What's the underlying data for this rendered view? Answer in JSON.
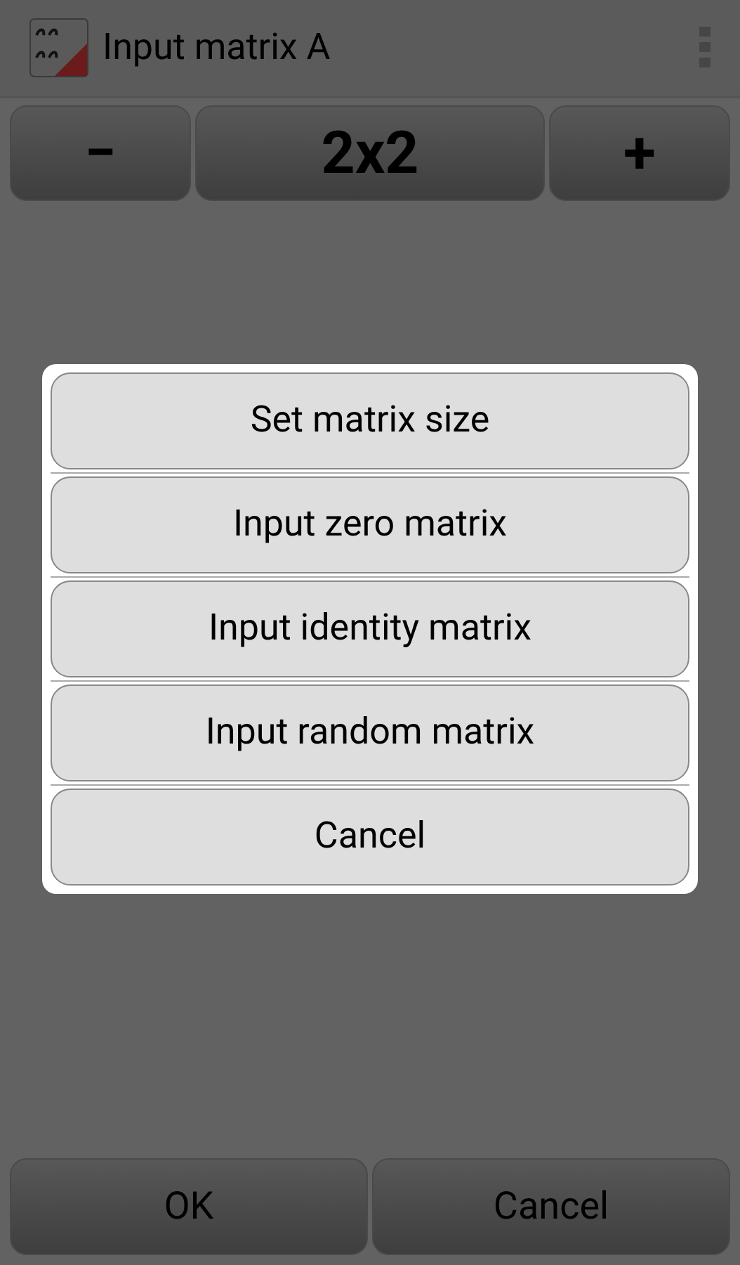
{
  "title_bar": {
    "title": "Input matrix A"
  },
  "size_controls": {
    "decrease": "−",
    "size": "2x2",
    "increase": "+"
  },
  "dialog": {
    "items": [
      "Set matrix size",
      "Input zero matrix",
      "Input identity matrix",
      "Input random matrix",
      "Cancel"
    ]
  },
  "footer_buttons": [
    "OK",
    "Cancel"
  ]
}
